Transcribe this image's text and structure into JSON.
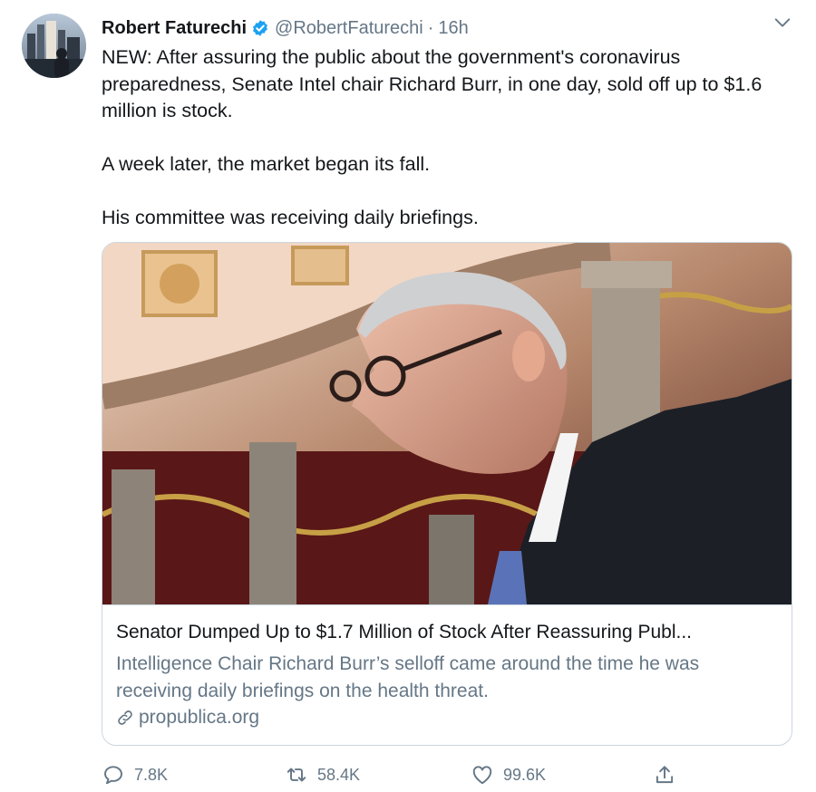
{
  "author": {
    "name": "Robert Faturechi",
    "handle": "@RobertFaturechi",
    "separator": "·",
    "time": "16h"
  },
  "tweet": {
    "paragraphs": [
      "NEW: After assuring the public about the government's coronavirus preparedness, Senate Intel chair Richard Burr, in one day, sold off up to $1.6 million is stock.",
      "A week later, the market began its fall.",
      "His committee was receiving daily briefings."
    ]
  },
  "card": {
    "title": "Senator Dumped Up to $1.7 Million of Stock After Reassuring Publ...",
    "description": "Intelligence Chair Richard Burr’s selloff came around the time he was receiving daily briefings on the health threat.",
    "domain": "propublica.org"
  },
  "actions": {
    "replies": "7.8K",
    "retweets": "58.4K",
    "likes": "99.6K"
  },
  "colors": {
    "verified": "#1da1f2",
    "secondary_text": "#657786",
    "border": "#ccd6dd"
  }
}
